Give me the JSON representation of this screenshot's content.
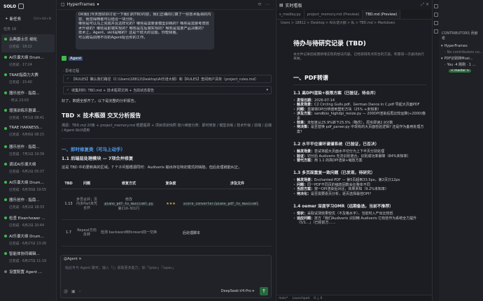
{
  "sidebar": {
    "brand": "SOLO",
    "new_task": "新任务",
    "new_task_shortcut": "Ctrl+Alt+N",
    "section": "任务",
    "section_count": "19",
    "tasks": [
      {
        "title": "古典爵士乐 细化",
        "sub": "已完成 · 18:22",
        "active": true
      },
      {
        "title": "AI乐谱大纲 Drum...",
        "sub": "已完成 · 17:24",
        "active": false
      },
      {
        "title": "TRAE指南力大赛",
        "sub": "已完成 · 15:40",
        "active": false
      },
      {
        "title": "器乐创作 · 指南...",
        "sub": "· 昨天 23:03",
        "active": false
      },
      {
        "title": "增强训练乐器谱...",
        "sub": "已完成 · 7月1日 08:41",
        "active": false
      },
      {
        "title": "TRAE HARNESS...",
        "sub": "已完成 · 6月8日 08:15",
        "active": false
      },
      {
        "title": "器乐创作 · 指南...",
        "sub": "已完成 · 7月1日 19:39",
        "active": false
      },
      {
        "title": "调试AI乐谱大纲",
        "sub": "已完成 · 6月2日 05:37",
        "active": false
      },
      {
        "title": "AI乐谱大纲 Drum...",
        "sub": "已完成 · 6月30日 19:55",
        "active": false
      },
      {
        "title": "器乐创作 · 指南...",
        "sub": "已完成 · 6月2日 18:33",
        "active": false
      },
      {
        "title": "检查 Eisenhower ...",
        "sub": "已完成 · 6月2日 20:44",
        "active": false
      },
      {
        "title": "AI乐谱大纲 Drum...",
        "sub": "已完成 · 6月27日 13:26",
        "active": false
      },
      {
        "title": "智能体协同编辑...",
        "sub": "已完成 · 6月27日 11:19",
        "active": false
      },
      {
        "title": "设置配置 Agent ...",
        "sub": "",
        "active": false
      }
    ]
  },
  "chat": {
    "project": "HyperFrames",
    "user_message": [
      "OK我们今天想好好讨论一下我们的TBD内容，我们正确的打算了一些技术瓶颈的内",
      "容，我觉得两者可以结合一块分析。",
      "哪些是可以马上完成并且这样化的？哪些是需要更模型训练的？哪些是需要考虑技",
      "术升级的？哪些是前端实现的？哪些是在后端实现的？哪些是需要产品决策的？",
      "技术上，Agent、skill是哪的？这是个很大的议题，你帮我看。",
      "可以跨岛调用不同的Agent配合你的工作。"
    ],
    "agent_name": "Agent",
    "thinking": "· 思考过程",
    "card1": "【RULES】确认我们路径（C:\\Users\\18812\\Desktop\\AI乐谱大纲）和【RULES】查阅用户清单（project_rules.md）",
    "card2": "收集材料: TBD.md + 技术瓶颈文档 + 当前状态报告",
    "intro": "好了，数据全部齐了。以下是完整的分析报告。",
    "report_title": "TBD × 技术瓶颈 交叉分析报告",
    "report_meta": "溯源：TBD.md 20条 + project_memory.md 根据瓶颈 + 项目现状快照 按六维度分类：即时修复 / 模型训练 / 技术升级 / 前端 / 后端 / Agent-Skill调用",
    "section1": "一、即时修复类（可马上动手）",
    "sub1": "1.1 后端层处理模块 — 7项合并修复",
    "sub1_desc": "这是 TBD 中的更新高的区域。7 个子问题根源同时：Audiveris 输出存在特定模式的缺陷，但后处理链能纠正。",
    "table_headers": [
      "TBD",
      "问题",
      "修复方式",
      "复杂度",
      "涉及文件"
    ],
    "rows": [
      {
        "tbd": "1.13",
        "issue": "步员合并；页内多Part未凭合并",
        "fix_a": "修改",
        "fix_code": "piano_pdf_to_musicxml.py",
        "fix_b": "第216-301行",
        "stars": "★★★",
        "file": "score_converter/piano_pdf_to_musicxml"
      },
      {
        "tbd": "1.7",
        "issue": "Repeat方向反转",
        "fix_a": "检测 backward到forward前一交换",
        "fix_code": "",
        "fix_b": "",
        "stars": "",
        "file": "后处理脚本"
      }
    ],
    "input_tag": "@Agent",
    "input_placeholder": "给此专与 Agent 聊天，输入「/」获取更多能力，如「/plan」「/spec」",
    "model": "DeepSeek-V4-Pro"
  },
  "editor": {
    "header": "实时看板",
    "tabs": [
      {
        "label": "s_medley.py",
        "on": false
      },
      {
        "label": "project_memory.md (Preview)",
        "on": false
      },
      {
        "label": "TBD.md (Preview)",
        "on": true
      }
    ],
    "breadcrumb": "Users > 18812 > Desktop > AI乐谱大纲 > 私 > TBD.md > Markdown",
    "doc_title": "待办与待研究记录 (TBD)",
    "doc_sub": "本文件记录后续需新增实现的想法内容，已经获得有点符合的方案，积累得一次通讯执行来做。",
    "h1": "一、PDF转谱",
    "groups": [
      {
        "title": "1.1 高DPI渲染+极限方案（已验证，待合并）",
        "items": [
          {
            "k": "发现日期：",
            "v": "2026-07-14"
          },
          {
            "k": "触发场景：",
            "v": "C2 Circling Gulls.pdf、German Dance in C.pdf 导起大页面PDF"
          },
          {
            "k": "问题：",
            "v": "直接将DPI分辨谱到塑形方块（25% +未知率）"
          },
          {
            "k": "涉及方案：",
            "v": "sandbox_highdpi_resize.py — 200DPI渲染后再比较运算(≈2000)像素"
          },
          {
            "k": "效果：",
            "v": "未知率从25.9%转下25.5%（略优），原实即读2.9分数"
          },
          {
            "k": "待决策：",
            "v": "是否替换 pdf_parser.py 中现有的大页面检验逻辑? 还是作为备用处理方案?"
          }
        ]
      },
      {
        "title": "1.2 水平平位谱环谱谱系统（已验证，已否决）",
        "items": [
          {
            "k": "触发场景：",
            "v": "尝试将超大页面水平切分为上下半页分别处理"
          },
          {
            "k": "验证：",
            "v": "切分后 Audiveris 无法识别谱合，识别成功率暴降（84%未知率）"
          },
          {
            "k": "替代方案：",
            "v": "用 1.1 的高DPI渲染+缩放方案"
          }
        ]
      },
      {
        "title": "1.3 多页面重复一致问题（已发现，待研究）",
        "items": [
          {
            "k": "触发场景：",
            "v": "Enchanted PDF — 第5页超到33.5px，第2页只12px"
          },
          {
            "k": "问题：",
            "v": "同一PDF不同页的缩放因数会在整体不同"
          },
          {
            "k": "当前方案：",
            "v": "按一DPI渲染后对比，效果未知（9.2%未知率）"
          },
          {
            "k": "待决化：",
            "v": "是否需要逐页分析，逐页选择最佳DPI?"
          }
        ]
      },
      {
        "title": "1.4 oemer 深度学习OMR（远期备选，当前不推荐）",
        "items": [
          {
            "k": "现状：",
            "v": "采取试测效果较优（不及格水平），当前时入产出比较低"
          },
          {
            "k": "适应问题：",
            "v": "技方「我们Audiveris 识别精 Audiveris 它有些作为系统全力提升（5/1…」（已经前方……"
          }
        ]
      }
    ],
    "status": [
      "main*",
      "Launchpad",
      "0 △ 0"
    ]
  },
  "explorer": {
    "head": "CONTRIBUTORS 贡献者",
    "items": [
      {
        "label": "HyperFrames",
        "dim": false
      },
      {
        "label": "No contributors co...",
        "dim": true
      },
      {
        "label": "PDF识别转Musi...",
        "dim": false
      },
      {
        "label": "You ·4 刚刚 · 1 ...",
        "dim": false
      },
      {
        "label": "< master >",
        "dim": false
      }
    ]
  }
}
